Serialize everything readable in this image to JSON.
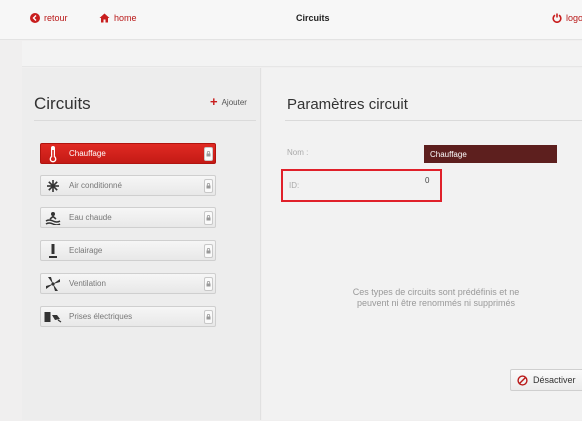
{
  "topbar": {
    "back_label": "retour",
    "home_label": "home",
    "title": "Circuits",
    "logout_label": "logo"
  },
  "left": {
    "title": "Circuits",
    "add_label": "Ajouter",
    "items": [
      {
        "label": "Chauffage",
        "icon": "thermometer-icon",
        "active": true
      },
      {
        "label": "Air conditionné",
        "icon": "snowflake-icon",
        "active": false
      },
      {
        "label": "Eau chaude",
        "icon": "water-icon",
        "active": false
      },
      {
        "label": "Eclairage",
        "icon": "lamp-icon",
        "active": false
      },
      {
        "label": "Ventilation",
        "icon": "fan-icon",
        "active": false
      },
      {
        "label": "Prises électriques",
        "icon": "plug-icon",
        "active": false
      }
    ]
  },
  "right": {
    "title": "Paramètres circuit",
    "nom_label": "Nom :",
    "nom_value": "Chauffage",
    "id_label": "ID:",
    "id_value": "0",
    "info_line1": "Ces types de circuits sont prédéfinis et ne",
    "info_line2": "peuvent ni être renommés ni supprimés",
    "deactivate_label": "Désactiver"
  },
  "colors": {
    "accent": "#c81d1d",
    "active_item": "#d8221c",
    "field_bg": "#5d1f1e",
    "highlight": "#e0202a"
  }
}
